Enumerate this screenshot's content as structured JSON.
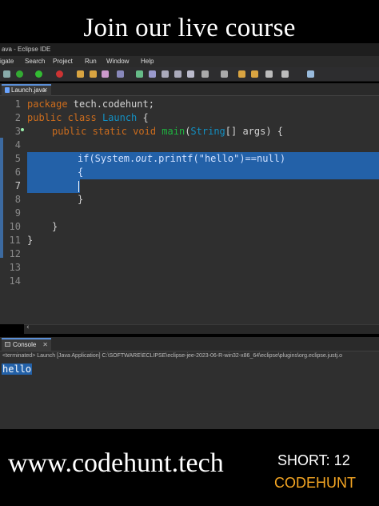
{
  "banner": {
    "top_title": "Join our live course",
    "website": "www.codehunt.tech",
    "short_label": "SHORT: 12",
    "brand": "CODEHUNT",
    "brand_color": "#f5a623"
  },
  "window": {
    "title": "ava - Eclipse IDE"
  },
  "menu": {
    "items": [
      "igate",
      "Search",
      "Project",
      "Run",
      "Window",
      "Help"
    ]
  },
  "editor_tab": {
    "label": "Launch.java",
    "close": "✕"
  },
  "editor": {
    "line_numbers": [
      "1",
      "2",
      "3",
      "4",
      "5",
      "6",
      "7",
      "8",
      "9",
      "10",
      "11",
      "12",
      "13",
      "14"
    ],
    "lines": {
      "l1_kw": "package",
      "l1_rest": " tech.codehunt;",
      "l2_kw": "public class",
      "l2_cls": "Launch",
      "l2_rest": " {",
      "l3_kw": "public static void",
      "l3_fn": "main",
      "l3_open": "(",
      "l3_type": "String",
      "l3_rest": "[] args) {",
      "l5_if": "if(System.",
      "l5_out": "out",
      "l5_mid": ".printf(",
      "l5_str": "\"hello\"",
      "l5_end": ")==null)",
      "l6": "{",
      "l8": "}",
      "l10": "}",
      "l11": "}"
    },
    "selected_lines": [
      5,
      6,
      7
    ]
  },
  "console": {
    "tab_label": "Console",
    "close": "✕",
    "status": "<terminated> Launch [Java Application] C:\\SOFTWARE\\ECLIPSE\\eclipse-jee-2023-06-R-win32-x86_64\\eclipse\\plugins\\org.eclipse.justj.o",
    "output": "hello"
  },
  "colors": {
    "selection": "#2361a8",
    "keyword": "#cc6c1d",
    "class": "#1290c3",
    "method": "#1eb540",
    "string": "#17c6a3"
  }
}
